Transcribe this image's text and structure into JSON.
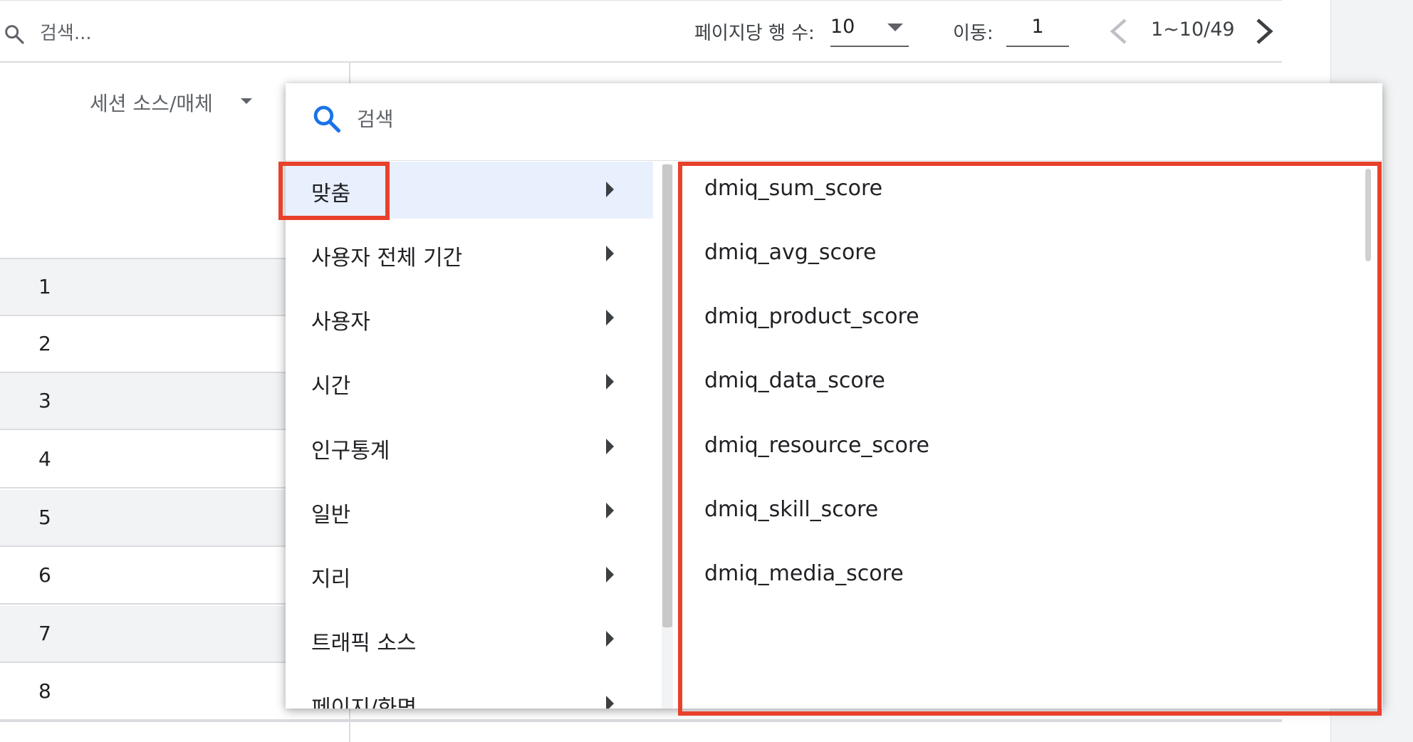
{
  "toolbar": {
    "search_placeholder": "검색...",
    "rows_per_page_label": "페이지당 행 수:",
    "rows_per_page_value": "10",
    "goto_label": "이동:",
    "goto_value": "1",
    "page_range": "1~10/49"
  },
  "table": {
    "column_header": "세션 소스/매체",
    "row_numbers": [
      "1",
      "2",
      "3",
      "4",
      "5",
      "6",
      "7",
      "8"
    ]
  },
  "popup": {
    "search_placeholder": "검색",
    "categories": [
      {
        "label": "맞춤",
        "selected": true
      },
      {
        "label": "사용자 전체 기간",
        "selected": false
      },
      {
        "label": "사용자",
        "selected": false
      },
      {
        "label": "시간",
        "selected": false
      },
      {
        "label": "인구통계",
        "selected": false
      },
      {
        "label": "일반",
        "selected": false
      },
      {
        "label": "지리",
        "selected": false
      },
      {
        "label": "트래픽 소스",
        "selected": false
      },
      {
        "label": "페이지/화면",
        "selected": false
      }
    ],
    "fields": [
      "dmiq_sum_score",
      "dmiq_avg_score",
      "dmiq_product_score",
      "dmiq_data_score",
      "dmiq_resource_score",
      "dmiq_skill_score",
      "dmiq_media_score"
    ]
  },
  "colors": {
    "highlight": "#e8412c",
    "selected_bg": "#e8f0fe",
    "search_icon": "#1a73e8"
  }
}
